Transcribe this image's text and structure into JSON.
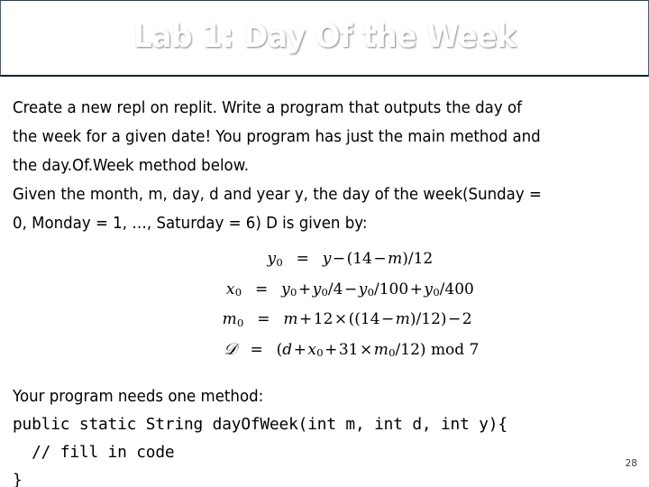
{
  "slide": {
    "title": "Lab 1: Day Of the Week",
    "page_number": "28",
    "accent_color_top": "#27486b",
    "accent_color_bottom": "#579dd5",
    "text_color": "#000000",
    "background_color": "#ffffff"
  },
  "body": {
    "lines": [
      "Create a new repl on replit. Write a program that outputs the day of",
      "the week for a given date! You program has just the main method and",
      "the day.Of.Week method below.",
      "Given the month, m, day, d and year y, the day of the week(Sunday =",
      "0, Monday = 1, …, Saturday = 6) D is given by:"
    ]
  },
  "equations": [
    {
      "lhs_base": "y",
      "lhs_sub": "0",
      "operator": "=",
      "rhs": "y − (14 − m)/12"
    },
    {
      "lhs_base": "x",
      "lhs_sub": "0",
      "operator": "=",
      "rhs": "y0 + y0/4 − y0/100 + y0/400"
    },
    {
      "lhs_base": "m",
      "lhs_sub": "0",
      "operator": "=",
      "rhs": "m + 12 × ((14 − m)/12) − 2"
    },
    {
      "lhs_base": "D",
      "lhs_sub": "",
      "operator": "=",
      "rhs": "(d + x0 + 31 × m0/12) mod 7"
    }
  ],
  "tail": {
    "prose": "Your program needs one method:",
    "code_lines": [
      "public static String dayOfWeek(int m, int d, int y){",
      "  // fill in code",
      "}"
    ]
  }
}
